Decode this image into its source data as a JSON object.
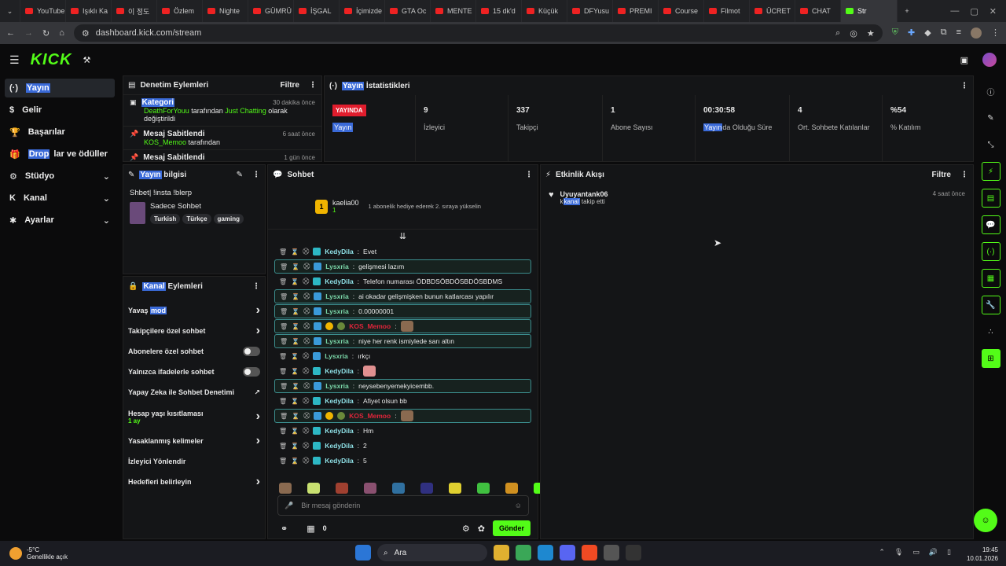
{
  "browser": {
    "tabs": [
      {
        "label": "YouTube"
      },
      {
        "label": "Işıklı Ka"
      },
      {
        "label": "이 정도"
      },
      {
        "label": "Özlem"
      },
      {
        "label": "Nighte"
      },
      {
        "label": "GÜMRÜ"
      },
      {
        "label": "İŞGAL"
      },
      {
        "label": "İçimizde"
      },
      {
        "label": "GTA Oc"
      },
      {
        "label": "MENTE"
      },
      {
        "label": "15 dk'd"
      },
      {
        "label": "Küçük"
      },
      {
        "label": "DFYusu"
      },
      {
        "label": "PREMI"
      },
      {
        "label": "Course"
      },
      {
        "label": "Filmot"
      },
      {
        "label": "ÜCRET"
      },
      {
        "label": "CHAT"
      },
      {
        "label": "Str"
      }
    ],
    "url": "dashboard.kick.com/stream"
  },
  "brand": {
    "logo": "KICK",
    "accent": "#53fc18"
  },
  "sidebar": {
    "items": [
      {
        "label": "Yayın",
        "icon": "broadcast-icon"
      },
      {
        "label": "Gelir",
        "icon": "dollar-icon"
      },
      {
        "label": "Başarılar",
        "icon": "trophy-icon"
      },
      {
        "label": "Drop",
        "label2": "lar ve ödüller",
        "icon": "gift-icon"
      },
      {
        "label": "Stüdyo",
        "icon": "gear-icon"
      },
      {
        "label": "Kanal",
        "icon": "k-icon"
      },
      {
        "label": "Ayarlar",
        "icon": "settings-icon"
      }
    ]
  },
  "moderation": {
    "title": "Denetim Eylemleri",
    "filter": "Filtre",
    "items": [
      {
        "title": "Kategori",
        "user": "DeathForYouu",
        "mid": " tarafından ",
        "target": "Just Chatting",
        "rest": " olarak değiştirildi",
        "time": "30 dakika önce"
      },
      {
        "title": "Mesaj Sabitlendi",
        "user": "KOS_Memoo",
        "mid": " tarafından",
        "time": "6 saat önce"
      },
      {
        "title": "Mesaj Sabitlendi",
        "time": "1 gün önce"
      }
    ]
  },
  "stats": {
    "title_hl": "Yayın",
    "title_rest": " İstatistikleri",
    "live_label": "YAYINDA",
    "live_sub": "Yayın",
    "items": [
      {
        "value": "9",
        "label": "İzleyici"
      },
      {
        "value": "337",
        "label": "Takipçi"
      },
      {
        "value": "1",
        "label": "Abone Sayısı"
      },
      {
        "value": "00:30:58",
        "label_hl": "Yayın",
        "label": "da Olduğu Süre"
      },
      {
        "value": "4",
        "label": "Ort. Sohbete Katılanlar"
      },
      {
        "value": "%54",
        "label": "% Katılım"
      }
    ]
  },
  "streaminfo": {
    "title_hl": "Yayın",
    "title_rest": " bilgisi",
    "stream_title": "Shbet| !insta !blerp",
    "category": "Sadece Sohbet",
    "tags": [
      "Turkish",
      "Türkçe",
      "gaming"
    ]
  },
  "channel_actions": {
    "title_hl": "Kanal",
    "title_rest": " Eylemleri",
    "items": [
      {
        "label": "Yavaş mod",
        "control": "chevron"
      },
      {
        "label": "Takipçilere özel sohbet",
        "control": "chevron"
      },
      {
        "label": "Abonelere özel sohbet",
        "control": "toggle"
      },
      {
        "label": "Yalnızca ifadelerle sohbet",
        "control": "toggle"
      },
      {
        "label": "Yapay Zeka ile Sohbet Denetimi",
        "control": "external"
      },
      {
        "label": "Hesap yaşı kısıtlaması",
        "sub": "1 ay",
        "control": "chevron"
      },
      {
        "label": "Yasaklanmış kelimeler",
        "control": "chevron"
      },
      {
        "label": "İzleyici Yönlendir",
        "control": "none"
      },
      {
        "label": "Hedefleri belirleyin",
        "control": "chevron"
      }
    ]
  },
  "chat": {
    "title": "Sohbet",
    "pinned_user": "kaelia00",
    "pinned_badge": "1",
    "pinned_text": "1 abonelik hediye ederek 2. sıraya yükselin",
    "messages": [
      {
        "user": "KedyDila",
        "text": "Evet",
        "boxed": false,
        "color": "#8fe0e6"
      },
      {
        "user": "Lysxria",
        "text": "gelişmesi lazım",
        "boxed": true,
        "color": "#7ad6a8"
      },
      {
        "user": "KedyDila",
        "text": "Telefon numarası ÖDBDSÖBDÖSBDÖSBDMS",
        "boxed": false,
        "color": "#8fe0e6"
      },
      {
        "user": "Lysxria",
        "text": "ai okadar gelişmişken bunun katlarcası yapılır",
        "boxed": true,
        "color": "#7ad6a8"
      },
      {
        "user": "Lysxria",
        "text": "0.00000001",
        "boxed": true,
        "color": "#7ad6a8"
      },
      {
        "user": "KOS_Memoo",
        "text": "",
        "boxed": true,
        "color": "#e0243a",
        "sub": true
      },
      {
        "user": "Lysxria",
        "text": "niye her renk ismiylede sarı altın",
        "boxed": true,
        "color": "#7ad6a8"
      },
      {
        "user": "Lysxria",
        "text": "ırkçı",
        "boxed": false,
        "color": "#7ad6a8"
      },
      {
        "user": "KedyDila",
        "text": "",
        "boxed": false,
        "color": "#8fe0e6",
        "emoji": true
      },
      {
        "user": "Lysxria",
        "text": "neysebenyemekyicembb.",
        "boxed": true,
        "color": "#7ad6a8"
      },
      {
        "user": "KedyDila",
        "text": "Afiyet olsun bb",
        "boxed": false,
        "color": "#8fe0e6"
      },
      {
        "user": "KOS_Memoo",
        "text": "",
        "boxed": true,
        "color": "#e0243a",
        "sub": true
      },
      {
        "user": "KedyDila",
        "text": "Hm",
        "boxed": false,
        "color": "#8fe0e6"
      },
      {
        "user": "KedyDila",
        "text": "2",
        "boxed": false,
        "color": "#8fe0e6"
      },
      {
        "user": "KedyDila",
        "text": "5",
        "boxed": false,
        "color": "#8fe0e6"
      }
    ],
    "input_placeholder": "Bir mesaj gönderin",
    "points": "0",
    "send_label": "Gönder"
  },
  "activity": {
    "title": "Etkinlik Akışı",
    "filter": "Filtre",
    "items": [
      {
        "user": "Uyuyantank06",
        "text_hl": "kanal",
        "text_pre": "k",
        "text": " takip etti",
        "time": "4 saat önce"
      }
    ]
  },
  "taskbar": {
    "temp": "-5°C",
    "weather": "Genellikle açık",
    "search": "Ara",
    "time": "19:45",
    "date": "10.01.2026"
  }
}
